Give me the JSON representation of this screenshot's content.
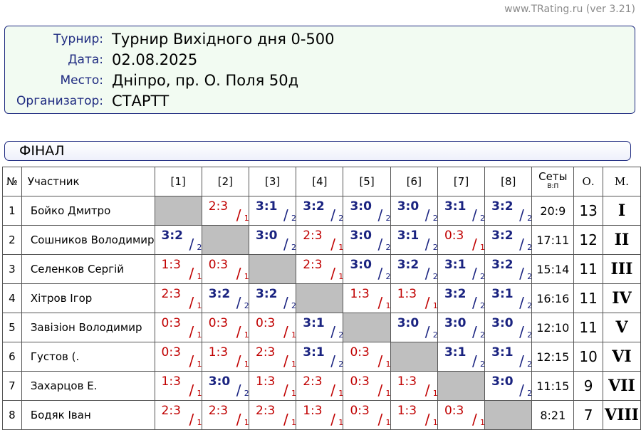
{
  "site": "www.TRating.ru (ver 3.21)",
  "info": [
    {
      "label": "Турнир:",
      "value": "Турнир Вихідного дня 0-500"
    },
    {
      "label": "Дата:",
      "value": "02.08.2025"
    },
    {
      "label": "Место:",
      "value": "Дніпро, пр. О. Поля 50д"
    },
    {
      "label": "Организатор:",
      "value": "СТАРТТ"
    }
  ],
  "stage": "ФІНАЛ",
  "headers": {
    "num": "№",
    "participant": "Участник",
    "cols": [
      "[1]",
      "[2]",
      "[3]",
      "[4]",
      "[5]",
      "[6]",
      "[7]",
      "[8]"
    ],
    "sets": "Сеты",
    "sets_sub": "В:П",
    "points": "О.",
    "place": "М."
  },
  "colors": {
    "win": "#1a2380",
    "loss": "#c00000",
    "diagonal": "#bfbfbf",
    "accent": "#1e2a80"
  },
  "rows": [
    {
      "num": "1",
      "name": "Бойко Дмитро",
      "cells": [
        null,
        "2:3",
        "3:1",
        "3:2",
        "3:0",
        "3:0",
        "3:1",
        "3:2"
      ],
      "sets": "20:9",
      "points": "13",
      "place": "I"
    },
    {
      "num": "2",
      "name": "Сошников Володимир",
      "cells": [
        "3:2",
        null,
        "3:0",
        "2:3",
        "3:0",
        "3:1",
        "0:3",
        "3:2"
      ],
      "sets": "17:11",
      "points": "12",
      "place": "II"
    },
    {
      "num": "3",
      "name": "Селенков Сергій",
      "cells": [
        "1:3",
        "0:3",
        null,
        "2:3",
        "3:0",
        "3:2",
        "3:1",
        "3:2"
      ],
      "sets": "15:14",
      "points": "11",
      "place": "III"
    },
    {
      "num": "4",
      "name": "Хітров Ігор",
      "cells": [
        "2:3",
        "3:2",
        "3:2",
        null,
        "1:3",
        "1:3",
        "3:2",
        "3:1"
      ],
      "sets": "16:16",
      "points": "11",
      "place": "IV"
    },
    {
      "num": "5",
      "name": "Завізіон Володимир",
      "cells": [
        "0:3",
        "0:3",
        "0:3",
        "3:1",
        null,
        "3:0",
        "3:0",
        "3:0"
      ],
      "sets": "12:10",
      "points": "11",
      "place": "V"
    },
    {
      "num": "6",
      "name": "Густов (.",
      "cells": [
        "0:3",
        "1:3",
        "2:3",
        "3:1",
        "0:3",
        null,
        "3:1",
        "3:1"
      ],
      "sets": "12:15",
      "points": "10",
      "place": "VI"
    },
    {
      "num": "7",
      "name": "Захарцов Е.",
      "cells": [
        "1:3",
        "3:0",
        "1:3",
        "2:3",
        "0:3",
        "1:3",
        null,
        "3:0"
      ],
      "sets": "11:15",
      "points": "9",
      "place": "VII"
    },
    {
      "num": "8",
      "name": "Бодяк Іван",
      "cells": [
        "2:3",
        "2:3",
        "2:3",
        "1:3",
        "0:3",
        "1:3",
        "0:3",
        null
      ],
      "sets": "8:21",
      "points": "7",
      "place": "VIII"
    }
  ]
}
